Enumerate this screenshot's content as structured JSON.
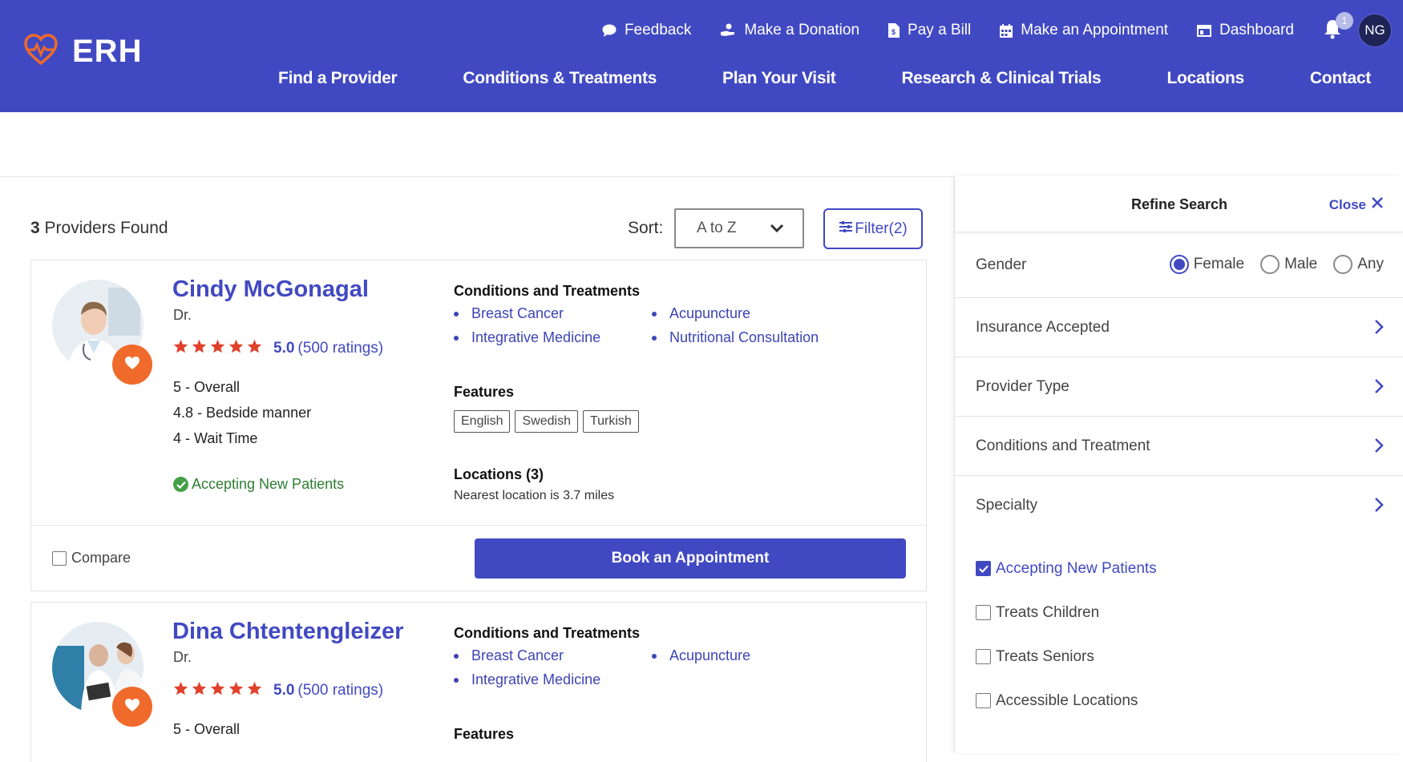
{
  "brand": {
    "name": "ERH"
  },
  "utility_nav": {
    "feedback": "Feedback",
    "donation": "Make a Donation",
    "pay_bill": "Pay a Bill",
    "appointment": "Make an Appointment",
    "dashboard": "Dashboard",
    "notification_count": "1",
    "user_initials": "NG"
  },
  "main_nav": [
    "Find a Provider",
    "Conditions & Treatments",
    "Plan Your Visit",
    "Research & Clinical Trials",
    "Locations",
    "Contact"
  ],
  "results": {
    "count": "3",
    "count_suffix": " Providers Found",
    "sort_label": "Sort:",
    "sort_value": "A to Z",
    "filter_label": "Filter(2)"
  },
  "providers": [
    {
      "name": "Cindy McGonagal",
      "title": "Dr.",
      "score": "5.0",
      "ratings": "(500 ratings)",
      "stars": 5,
      "metrics": [
        "5 - Overall",
        "4.8 - Bedside manner",
        "4 - Wait Time"
      ],
      "accepting": "Accepting New Patients",
      "conditions_title": "Conditions and Treatments",
      "conditions": [
        "Breast Cancer",
        "Acupuncture",
        "Integrative Medicine",
        "Nutritional Consultation"
      ],
      "features_title": "Features",
      "features": [
        "English",
        "Swedish",
        "Turkish"
      ],
      "locations_title": "Locations (3)",
      "locations_sub": "Nearest location is 3.7 miles",
      "compare": "Compare",
      "book": "Book an Appointment"
    },
    {
      "name": "Dina Chtentengleizer",
      "title": "Dr.",
      "score": "5.0",
      "ratings": "(500 ratings)",
      "stars": 5,
      "metrics": [
        "5 - Overall"
      ],
      "conditions_title": "Conditions and Treatments",
      "conditions": [
        "Breast Cancer",
        "Acupuncture",
        "Integrative Medicine"
      ],
      "features_title": "Features"
    }
  ],
  "refine": {
    "title": "Refine Search",
    "close": "Close",
    "gender_label": "Gender",
    "gender_options": [
      "Female",
      "Male",
      "Any"
    ],
    "gender_selected": "Female",
    "rows": [
      "Insurance Accepted",
      "Provider Type",
      "Conditions and Treatment",
      "Specialty"
    ],
    "checks": [
      {
        "label": "Accepting New Patients",
        "checked": true
      },
      {
        "label": "Treats Children",
        "checked": false
      },
      {
        "label": "Treats Seniors",
        "checked": false
      },
      {
        "label": "Accessible Locations",
        "checked": false
      }
    ]
  },
  "colors": {
    "brand": "#4149c2",
    "accent": "#ef6a2b",
    "star": "#e0412b",
    "success": "#43a047"
  }
}
